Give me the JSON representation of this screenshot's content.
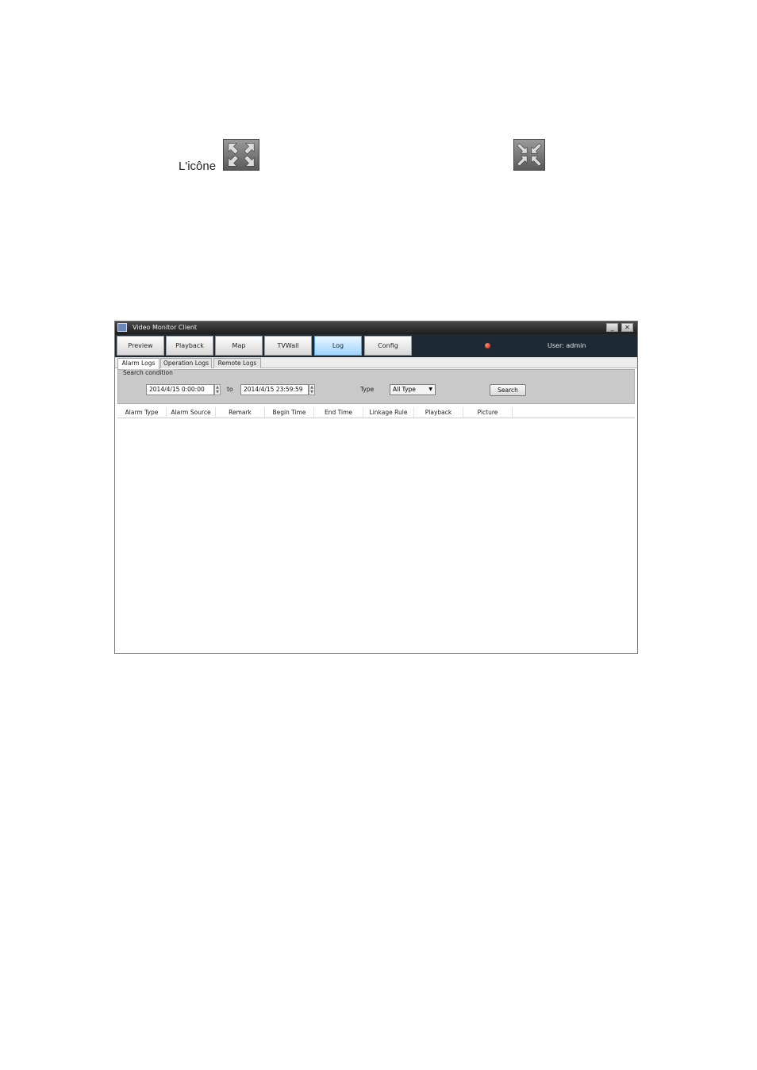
{
  "doc": {
    "text": "L'icône"
  },
  "window": {
    "title": "Video Monitor Client",
    "buttons": {
      "minimize": "_",
      "close": "✕"
    },
    "nav": [
      "Preview",
      "Playback",
      "Map",
      "TVWall",
      "Log",
      "Config"
    ],
    "active_nav": "Log",
    "user": "User: admin"
  },
  "subtabs": [
    "Alarm Logs",
    "Operation Logs",
    "Remote Logs"
  ],
  "search": {
    "legend": "Search condition",
    "from": "2014/4/15 0:00:00",
    "to_label": "to",
    "to": "2014/4/15 23:59:59",
    "type_label": "Type",
    "type_value": "All Type",
    "button": "Search"
  },
  "columns": [
    "Alarm Type",
    "Alarm Source",
    "Remark",
    "Begin Time",
    "End Time",
    "Linkage Rule",
    "Playback",
    "Picture"
  ],
  "colors": {
    "navbar": "#1d2a33",
    "active_tab": "#9fd4ff",
    "alarm": "#d02000"
  }
}
